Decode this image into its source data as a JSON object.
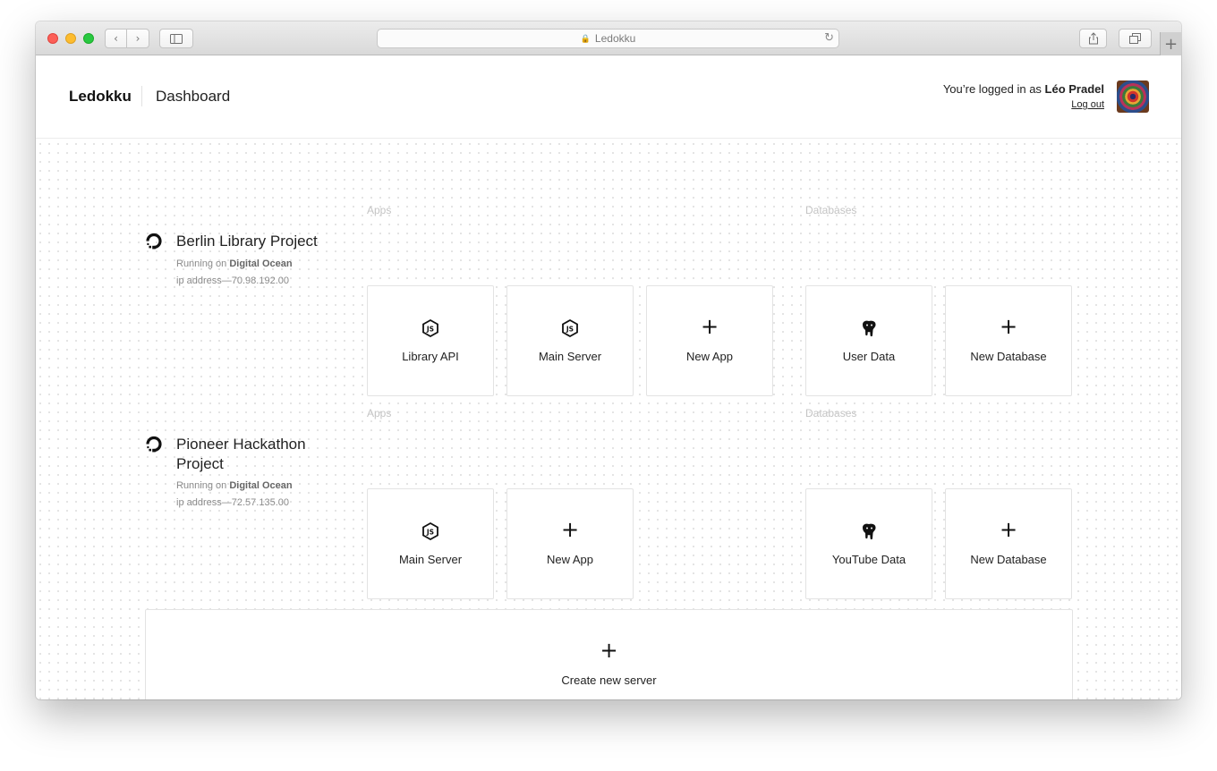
{
  "browser": {
    "address": "Ledokku"
  },
  "header": {
    "brand": "Ledokku",
    "page_title": "Dashboard",
    "login_prefix": "You’re logged in as ",
    "user_name": "Léo Pradel",
    "logout_label": "Log out"
  },
  "servers": [
    {
      "name": "Berlin Library Project",
      "running_prefix": "Running on ",
      "provider": "Digital Ocean",
      "ip": "ip address—70.98.192.00",
      "apps_label": "Apps",
      "databases_label": "Databases",
      "apps": [
        "Library API",
        "Main Server"
      ],
      "new_app_label": "New App",
      "databases": [
        "User Data"
      ],
      "new_database_label": "New Database"
    },
    {
      "name_line1": "Pioneer Hackathon",
      "name_line2": "Project",
      "running_prefix": "Running on ",
      "provider": "Digital Ocean",
      "ip": "ip address—72.57.135.00",
      "apps_label": "Apps",
      "databases_label": "Databases",
      "apps": [
        "Main Server"
      ],
      "new_app_label": "New App",
      "databases": [
        "YouTube Data"
      ],
      "new_database_label": "New Database"
    }
  ],
  "create_server_label": "Create new server",
  "icons": {
    "server": "digitalocean-icon",
    "app": "nodejs-icon",
    "database": "postgresql-icon",
    "add": "plus-icon"
  }
}
